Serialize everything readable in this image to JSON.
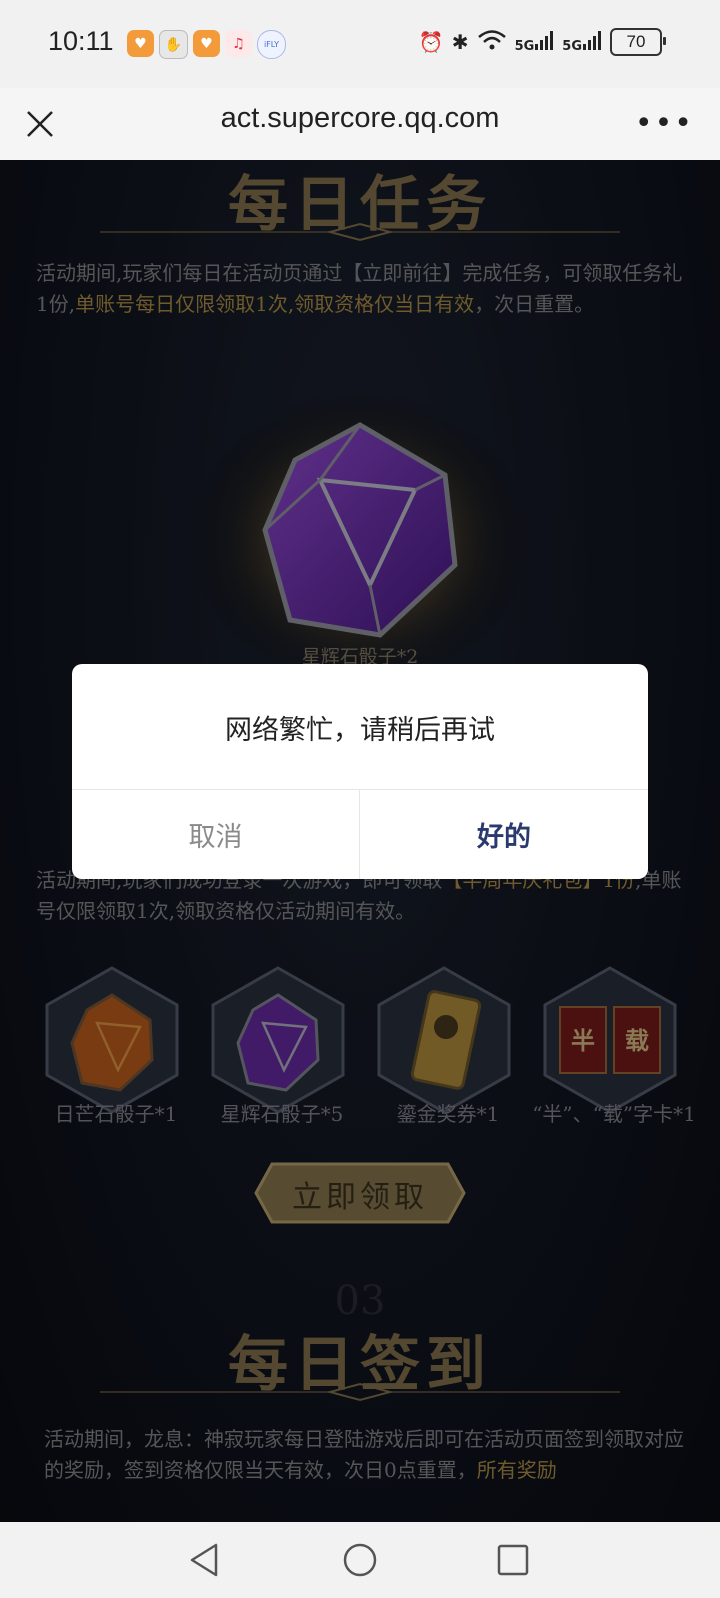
{
  "status_bar": {
    "time": "10:11",
    "app_icons": [
      "heart-app-icon",
      "hand-app-icon",
      "heart-app-icon",
      "music-app-icon",
      "ifly-app-icon"
    ],
    "ifly_label": "iFLY",
    "signal_1": "5G",
    "signal_2": "5G",
    "battery": "70"
  },
  "browser": {
    "url": "act.supercore.qq.com",
    "more_label": "•••"
  },
  "page": {
    "daily_task": {
      "title": "每日任务",
      "desc_prefix": "活动期间,玩家们每日在活动页通过【立即前往】完成任务，可领取任务礼1份,",
      "desc_highlight": "单账号每日仅限领取1次,领取资格仅当日有效",
      "desc_suffix": "，次日重置。",
      "prize_label": "星辉石骰子*2"
    },
    "anniversary": {
      "desc_prefix": "活动期间,玩家们成功登录一次游戏，即可领取",
      "desc_highlight": "【半周年庆礼包】1份",
      "desc_suffix": ",单账号仅限领取1次,领取资格仅活动期间有效。",
      "rewards": [
        {
          "label": "日芒石骰子*1"
        },
        {
          "label": "星辉石骰子*5"
        },
        {
          "label": "鎏金奖券*1"
        },
        {
          "label": "“半”、“载”字卡*1"
        }
      ],
      "card_chars": [
        "半",
        "载"
      ],
      "claim_button": "立即领取"
    },
    "daily_signin": {
      "number": "03",
      "title": "每日签到",
      "desc_prefix": "活动期间，龙息：神寂玩家每日登陆游戏后即可在活动页面签到领取对应的奖励，签到资格仅限当天有效，次日0点重置，",
      "desc_highlight": "所有奖励"
    }
  },
  "dialog": {
    "message": "网络繁忙，请稍后再试",
    "cancel": "取消",
    "ok": "好的"
  },
  "colors": {
    "accent_gold": "#b39347",
    "dialog_ok": "#2a3a6e",
    "page_bg": "#0c0f16"
  }
}
